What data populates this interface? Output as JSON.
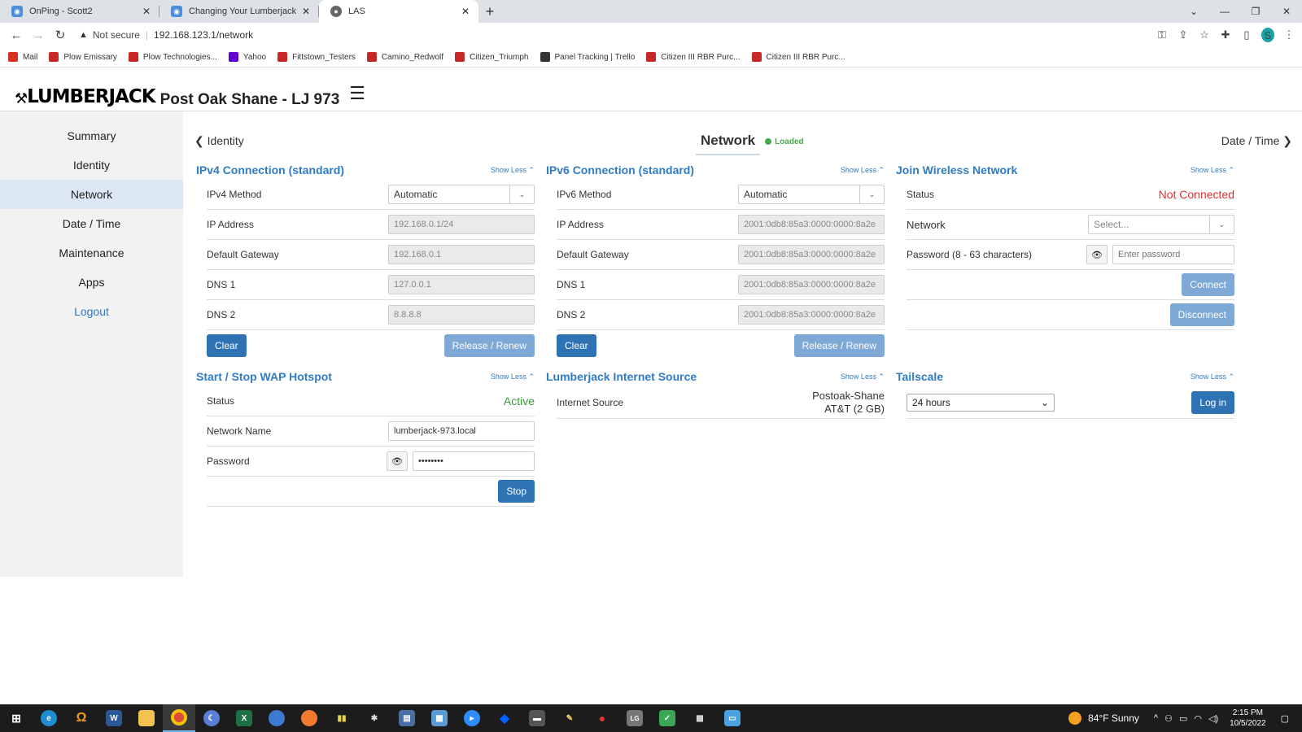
{
  "browser": {
    "tabs": [
      {
        "title": "OnPing - Scott2",
        "close": "✕",
        "icon": "onping-icon"
      },
      {
        "title": "Changing Your Lumberjack Netw",
        "close": "✕",
        "icon": "onping-icon"
      },
      {
        "title": "LAS",
        "close": "✕",
        "icon": "globe-icon"
      }
    ],
    "new_tab": "+",
    "not_secure": "Not secure",
    "url": "192.168.123.1/network",
    "profile_initial": "S",
    "bookmarks": [
      {
        "label": "Mail",
        "color": "#d93025"
      },
      {
        "label": "Plow Emissary",
        "color": "#c62828"
      },
      {
        "label": "Plow Technologies...",
        "color": "#c62828"
      },
      {
        "label": "Yahoo",
        "color": "#6001d2"
      },
      {
        "label": "Fittstown_Testers",
        "color": "#c62828"
      },
      {
        "label": "Camino_Redwolf",
        "color": "#c62828"
      },
      {
        "label": "Citizen_Triumph",
        "color": "#c62828"
      },
      {
        "label": "Panel Tracking | Trello",
        "color": "#333333"
      },
      {
        "label": "Citizen III RBR Purc...",
        "color": "#c62828"
      },
      {
        "label": "Citizen III RBR Purc...",
        "color": "#c62828"
      }
    ]
  },
  "app": {
    "logo": "LUMBERJACK",
    "site_title": "Post Oak Shane - LJ 973",
    "sidebar": [
      {
        "label": "Summary"
      },
      {
        "label": "Identity"
      },
      {
        "label": "Network"
      },
      {
        "label": "Date / Time"
      },
      {
        "label": "Maintenance"
      },
      {
        "label": "Apps"
      },
      {
        "label": "Logout"
      }
    ],
    "nav": {
      "prev": "Identity",
      "next": "Date / Time",
      "title": "Network",
      "status": "Loaded"
    },
    "show_less": "Show Less",
    "ipv4": {
      "title": "IPv4 Connection (standard)",
      "method_label": "IPv4 Method",
      "method_value": "Automatic",
      "ip_label": "IP Address",
      "ip_value": "192.168.0.1/24",
      "gw_label": "Default Gateway",
      "gw_value": "192.168.0.1",
      "dns1_label": "DNS 1",
      "dns1_value": "127.0.0.1",
      "dns2_label": "DNS 2",
      "dns2_value": "8.8.8.8",
      "clear": "Clear",
      "renew": "Release / Renew"
    },
    "ipv6": {
      "title": "IPv6 Connection (standard)",
      "method_label": "IPv6 Method",
      "method_value": "Automatic",
      "ip_label": "IP Address",
      "ip_value": "2001:0db8:85a3:0000:0000:8a2e",
      "gw_label": "Default Gateway",
      "gw_value": "2001:0db8:85a3:0000:0000:8a2e",
      "dns1_label": "DNS 1",
      "dns1_value": "2001:0db8:85a3:0000:0000:8a2e",
      "dns2_label": "DNS 2",
      "dns2_value": "2001:0db8:85a3:0000:0000:8a2e",
      "clear": "Clear",
      "renew": "Release / Renew"
    },
    "wireless": {
      "title": "Join Wireless Network",
      "status_label": "Status",
      "status_value": "Not Connected",
      "network_label": "Network",
      "network_placeholder": "Select...",
      "password_label": "Password (8 - 63 characters)",
      "password_placeholder": "Enter password",
      "connect": "Connect",
      "disconnect": "Disconnect"
    },
    "wap": {
      "title": "Start / Stop WAP Hotspot",
      "status_label": "Status",
      "status_value": "Active",
      "name_label": "Network Name",
      "name_value": "lumberjack-973.local",
      "password_label": "Password",
      "password_value": "••••••••",
      "stop": "Stop"
    },
    "internet": {
      "title": "Lumberjack Internet Source",
      "source_label": "Internet Source",
      "source_line1": "Postoak-Shane",
      "source_line2": "AT&T (2 GB)"
    },
    "tailscale": {
      "title": "Tailscale",
      "duration_value": "24 hours",
      "login": "Log in"
    }
  },
  "taskbar": {
    "weather": "84°F  Sunny",
    "time": "2:15 PM",
    "date": "10/5/2022"
  }
}
